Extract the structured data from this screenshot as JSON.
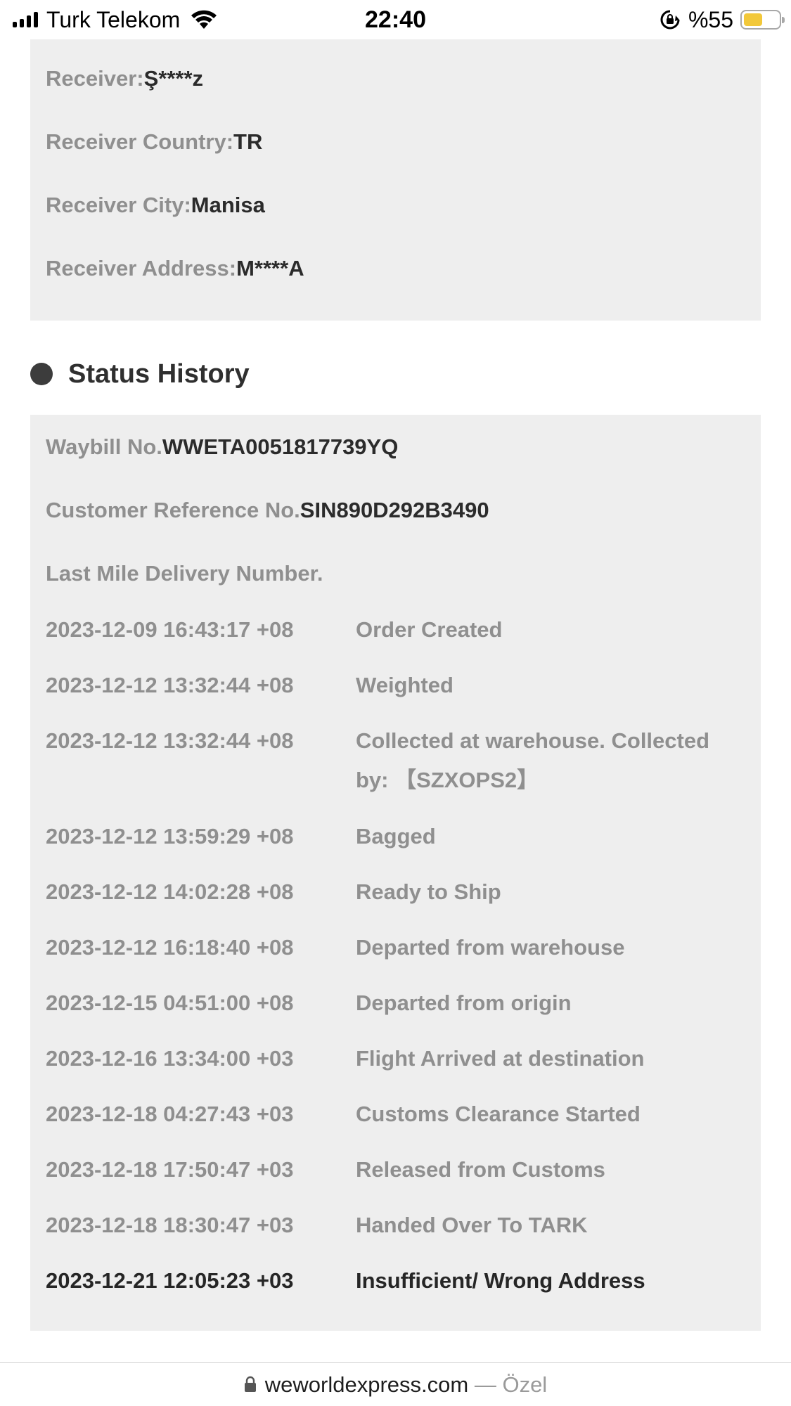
{
  "status_bar": {
    "carrier": "Turk Telekom",
    "time": "22:40",
    "battery_percent": "%55",
    "battery_level": 0.55,
    "battery_color": "#f2c83a",
    "icons": [
      "signal-icon",
      "wifi-icon",
      "rotation-lock-icon",
      "battery-icon"
    ]
  },
  "receiver": {
    "name_label": "Receiver:",
    "name_value": "Ş****z",
    "country_label": "Receiver Country:",
    "country_value": "TR",
    "city_label": "Receiver City:",
    "city_value": "Manisa",
    "address_label": "Receiver Address:",
    "address_value": "M****A"
  },
  "status_history": {
    "title": "Status History",
    "waybill_label": "Waybill No.",
    "waybill_value": "WWETA0051817739YQ",
    "customer_ref_label": "Customer Reference No.",
    "customer_ref_value": "SIN890D292B3490",
    "last_mile_label": "Last Mile Delivery Number.",
    "events": [
      {
        "time": "2023-12-09 16:43:17 +08",
        "description": "Order Created"
      },
      {
        "time": "2023-12-12 13:32:44 +08",
        "description": "Weighted"
      },
      {
        "time": "2023-12-12 13:32:44 +08",
        "description": "Collected at warehouse. Collected by: 【SZXOPS2】"
      },
      {
        "time": "2023-12-12 13:59:29 +08",
        "description": "Bagged"
      },
      {
        "time": "2023-12-12 14:02:28 +08",
        "description": "Ready to Ship"
      },
      {
        "time": "2023-12-12 16:18:40 +08",
        "description": "Departed from warehouse"
      },
      {
        "time": "2023-12-15 04:51:00 +08",
        "description": "Departed from origin"
      },
      {
        "time": "2023-12-16 13:34:00 +03",
        "description": "Flight Arrived at destination"
      },
      {
        "time": "2023-12-18 04:27:43 +03",
        "description": "Customs Clearance Started"
      },
      {
        "time": "2023-12-18 17:50:47 +03",
        "description": "Released from Customs"
      },
      {
        "time": "2023-12-18 18:30:47 +03",
        "description": "Handed Over To TARK"
      },
      {
        "time": "2023-12-21 12:05:23 +03",
        "description": "Insufficient/ Wrong Address"
      }
    ]
  },
  "browser": {
    "domain": "weworldexpress.com",
    "separator": " — ",
    "privacy_label": "Özel"
  },
  "colors": {
    "card_background": "#eeeeee",
    "label_gray": "#8f8f8f",
    "value_dark": "#2b2b2b"
  }
}
